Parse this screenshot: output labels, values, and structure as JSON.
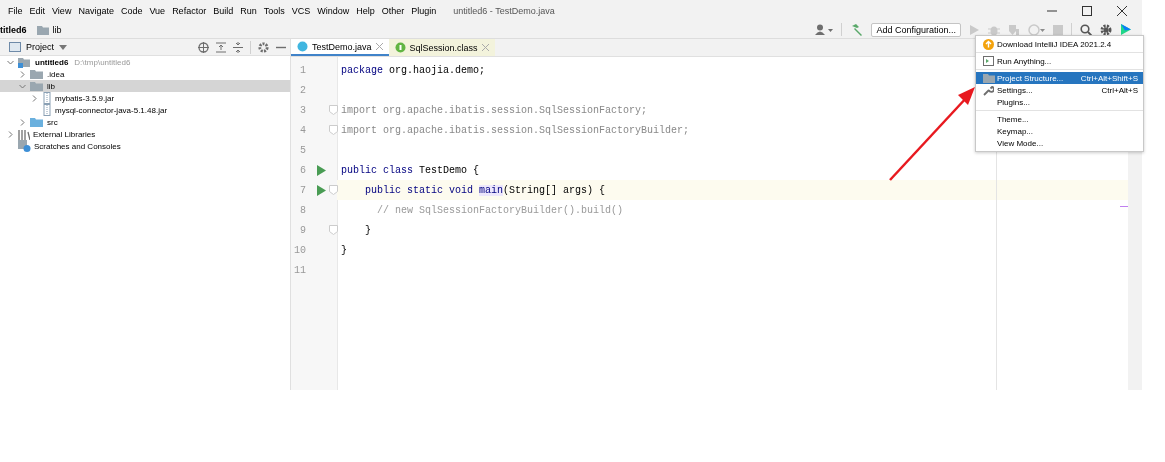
{
  "menu_bar": {
    "items": [
      "File",
      "Edit",
      "View",
      "Navigate",
      "Code",
      "Vue",
      "Refactor",
      "Build",
      "Run",
      "Tools",
      "VCS",
      "Window",
      "Help",
      "Other",
      "Plugin"
    ],
    "title": "untitled6 - TestDemo.java"
  },
  "nav_bar": {
    "crumbs": [
      "titled6",
      "lib"
    ],
    "run_config": "Add Configuration..."
  },
  "project_panel": {
    "title": "Project",
    "tree": [
      {
        "label": "untitled6",
        "path": "D:\\tmp\\untitled6",
        "kind": "module",
        "expanded": true,
        "selected": false,
        "children": [
          {
            "label": ".idea",
            "kind": "folder",
            "expanded": false,
            "selected": false
          },
          {
            "label": "lib",
            "kind": "folder",
            "expanded": true,
            "selected": true,
            "children": [
              {
                "label": "mybatis-3.5.9.jar",
                "kind": "jar",
                "expanded": false,
                "selected": false
              },
              {
                "label": "mysql-connector-java-5.1.48.jar",
                "kind": "jar",
                "selected": false
              }
            ]
          },
          {
            "label": "src",
            "kind": "src",
            "expanded": false,
            "selected": false
          }
        ]
      },
      {
        "label": "External Libraries",
        "kind": "libraries",
        "expanded": false,
        "selected": false
      },
      {
        "label": "Scratches and Consoles",
        "kind": "scratches",
        "selected": false
      }
    ]
  },
  "editor": {
    "tabs": [
      {
        "label": "TestDemo.java",
        "kind": "java",
        "selected": true
      },
      {
        "label": "SqlSession.class",
        "kind": "class",
        "selected": false
      }
    ],
    "lines": [
      {
        "number": "1",
        "kind": "top",
        "current": false,
        "run": false,
        "fold": false,
        "tokens": [
          {
            "text": "package",
            "kind": "keyword"
          },
          {
            "text": " org.haojia.demo;",
            "kind": "plain"
          }
        ]
      },
      {
        "number": "2",
        "current": false,
        "run": false,
        "fold": false
      },
      {
        "number": "3",
        "kind": "top",
        "current": false,
        "run": false,
        "fold": true,
        "tokens": [
          {
            "text": "import org.apache.ibatis.session.SqlSessionFactory;",
            "kind": "unused"
          }
        ]
      },
      {
        "number": "4",
        "kind": "top",
        "current": false,
        "run": false,
        "fold": true,
        "tokens": [
          {
            "text": "import org.apache.ibatis.session.SqlSessionFactoryBuilder;",
            "kind": "unused"
          }
        ]
      },
      {
        "number": "5",
        "current": false,
        "run": false,
        "fold": false
      },
      {
        "number": "6",
        "kind": "top",
        "current": false,
        "run": true,
        "fold": false,
        "tokens": [
          {
            "text": "public class",
            "kind": "keyword"
          },
          {
            "text": " TestDemo {",
            "kind": "plain"
          }
        ]
      },
      {
        "number": "7",
        "kind": "member",
        "current": true,
        "run": true,
        "fold": true,
        "tokens": [
          {
            "text": "public static void",
            "kind": "keyword"
          },
          {
            "text": "main",
            "kind": "highlight"
          },
          {
            "text": "(String[] args) {",
            "kind": "plain"
          }
        ]
      },
      {
        "number": "8",
        "kind": "statement",
        "current": false,
        "run": false,
        "fold": false,
        "tokens": [
          {
            "text": "// new SqlSessionFactoryBuilder().build()",
            "kind": "comment"
          }
        ]
      },
      {
        "number": "9",
        "kind": "member",
        "current": false,
        "run": false,
        "fold": true,
        "tokens": [
          {
            "text": "}",
            "kind": "plain"
          }
        ]
      },
      {
        "number": "10",
        "kind": "top",
        "current": false,
        "run": false,
        "fold": false,
        "tokens": [
          {
            "text": "}",
            "kind": "plain"
          }
        ]
      },
      {
        "number": "11",
        "current": false,
        "run": false,
        "fold": false
      }
    ]
  },
  "popup_menu": {
    "groups": [
      [
        {
          "label": "Download IntelliJ IDEA 2021.2.4",
          "kind": "download",
          "selected": false
        }
      ],
      [
        {
          "label": "Run Anything...",
          "kind": "run",
          "selected": false
        }
      ],
      [
        {
          "label": "Project Structure...",
          "kind": "folder",
          "shortcut": "Ctrl+Alt+Shift+S",
          "selected": true
        },
        {
          "label": "Settings...",
          "kind": "wrench",
          "shortcut": "Ctrl+Alt+S",
          "selected": false
        },
        {
          "label": "Plugins...",
          "selected": false
        }
      ],
      [
        {
          "label": "Theme...",
          "selected": false
        },
        {
          "label": "Keymap...",
          "selected": false
        },
        {
          "label": "View Mode...",
          "selected": false
        }
      ]
    ]
  }
}
